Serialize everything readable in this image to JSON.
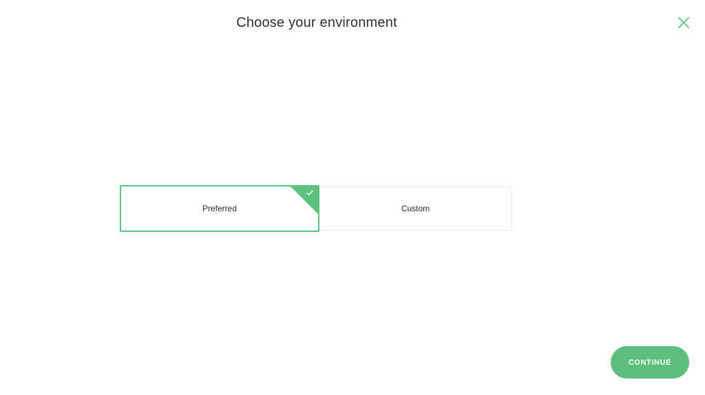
{
  "header": {
    "title": "Choose your environment"
  },
  "close_button": {
    "icon": "close-icon"
  },
  "options": [
    {
      "label": "Preferred",
      "selected": true,
      "icon": "check-icon"
    },
    {
      "label": "Custom",
      "selected": false
    }
  ],
  "footer": {
    "continue_label": "CONTINUE"
  },
  "colors": {
    "accent": "#5cc27e",
    "button": "#5cbf7d",
    "border_light": "#e8e8e8",
    "text": "#2c2c2c"
  }
}
